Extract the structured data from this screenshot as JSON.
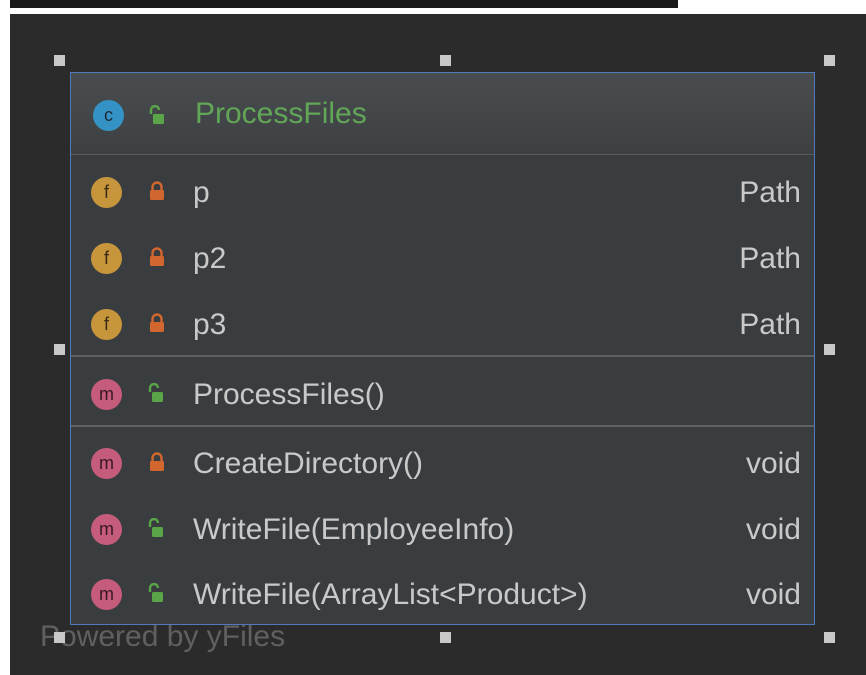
{
  "class": {
    "name": "ProcessFiles",
    "kind_badge": "c"
  },
  "fields": [
    {
      "badge": "f",
      "visibility": "private",
      "name": "p",
      "type": "Path"
    },
    {
      "badge": "f",
      "visibility": "private",
      "name": "p2",
      "type": "Path"
    },
    {
      "badge": "f",
      "visibility": "private",
      "name": "p3",
      "type": "Path"
    }
  ],
  "constructors": [
    {
      "badge": "m",
      "visibility": "public",
      "name": "ProcessFiles()"
    }
  ],
  "methods": [
    {
      "badge": "m",
      "visibility": "private",
      "name": "CreateDirectory()",
      "type": "void"
    },
    {
      "badge": "m",
      "visibility": "public",
      "name": "WriteFile(EmployeeInfo)",
      "type": "void"
    },
    {
      "badge": "m",
      "visibility": "public",
      "name": "WriteFile(ArrayList<Product>)",
      "type": "void"
    }
  ],
  "watermark": "Powered by yFiles",
  "colors": {
    "canvas": "#2b2b2b",
    "selection_border": "#4f7bbd",
    "public_lock": "#5aa548",
    "private_lock": "#d2662f",
    "class_badge": "#3592c4",
    "field_badge": "#c7953b",
    "method_badge": "#c65c7b"
  }
}
